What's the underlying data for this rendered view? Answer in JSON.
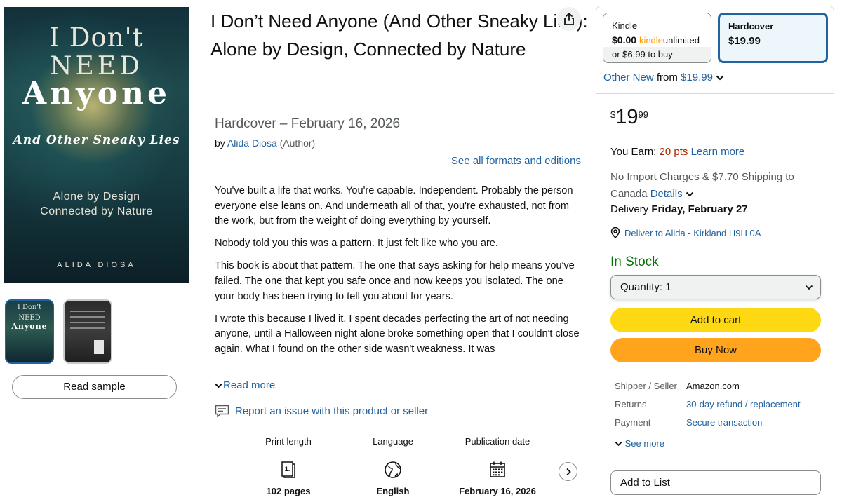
{
  "cover": {
    "line1": "I Don't",
    "line2": "NEED",
    "line3": "Anyone",
    "subtitle": "And Other Sneaky Lies",
    "tagline1": "Alone by Design",
    "tagline2": "Connected by Nature",
    "author": "ALIDA DIOSA"
  },
  "thumbnails": {
    "front": {
      "line1": "I Don't",
      "line2": "NEED",
      "line3": "Anyone"
    }
  },
  "read_sample_label": "Read sample",
  "product": {
    "title": "I Don’t Need Anyone (And Other Sneaky Lies): Alone by Design, Connected by Nature",
    "format_line": "Hardcover – February 16, 2026",
    "by_prefix": "by",
    "author": "Alida Diosa",
    "author_role": "(Author)",
    "see_all_formats": "See all formats and editions"
  },
  "description": {
    "paragraphs": [
      "You've built a life that works. You're capable. Independent. Probably the person everyone else leans on. And underneath all of that, you're exhausted, not from the work, but from the weight of doing everything by yourself.",
      "Nobody told you this was a pattern. It just felt like who you are.",
      "This book is about that pattern. The one that says asking for help means you've failed. The one that kept you safe once and now keeps you isolated. The one your body has been trying to tell you about for years.",
      "I wrote this because I lived it. I spent decades perfecting the art of not needing anyone, until a Halloween night alone broke something open that I couldn't close again. What I found on the other side wasn't weakness. It was"
    ],
    "read_more": "Read more"
  },
  "report_issue": "Report an issue with this product or seller",
  "details": [
    {
      "label": "Print length",
      "icon": "page-icon",
      "value": "102 pages"
    },
    {
      "label": "Language",
      "icon": "globe-icon",
      "value": "English"
    },
    {
      "label": "Publication date",
      "icon": "calendar-icon",
      "value": "February 16, 2026"
    }
  ],
  "buybox": {
    "formats": {
      "kindle": {
        "name": "Kindle",
        "price": "$0.00",
        "ku_kindle": "kindle",
        "ku_unlimited": "unlimited",
        "buy_price": "or $6.99",
        "buy_suffix": "to buy"
      },
      "hardcover": {
        "name": "Hardcover",
        "price": "$19.99"
      }
    },
    "other_new_label": "Other New",
    "other_new_from": "from",
    "other_new_price": "$19.99",
    "price": {
      "symbol": "$",
      "whole": "19",
      "fraction": "99"
    },
    "earn": {
      "prefix": "You Earn:",
      "points": "20 pts",
      "learn_more": "Learn more"
    },
    "shipping": {
      "text": "No Import Charges & $7.70 Shipping to Canada",
      "details_link": "Details"
    },
    "delivery": {
      "prefix": "Delivery",
      "date": "Friday, February 27"
    },
    "deliver_to": "Deliver to Alida - Kirkland H9H 0A",
    "stock": "In Stock",
    "quantity": {
      "label": "Quantity:",
      "value": "1"
    },
    "add_to_cart": "Add to cart",
    "buy_now": "Buy Now",
    "info": {
      "shipper_label": "Shipper / Seller",
      "shipper_value": "Amazon.com",
      "returns_label": "Returns",
      "returns_value": "30-day refund / replacement",
      "payment_label": "Payment",
      "payment_value": "Secure transaction",
      "see_more": "See more"
    },
    "add_to_list": "Add to List"
  },
  "colors": {
    "link": "#2162a1",
    "price_accent": "#b12704",
    "in_stock": "#007600",
    "add_to_cart": "#ffd814",
    "buy_now": "#ffa41c",
    "selected_format_border": "#2162a1"
  }
}
